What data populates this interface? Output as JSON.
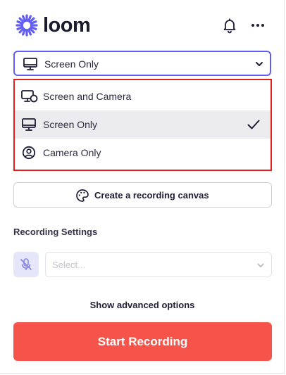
{
  "header": {
    "logo_text": "loom",
    "logo_icon": "loom-starburst-icon",
    "notifications_icon": "bell-icon",
    "more_icon": "more-horizontal-icon"
  },
  "recording_mode": {
    "selected_value": "Screen Only",
    "options": [
      {
        "label": "Screen and Camera",
        "icon": "monitor-camera-icon",
        "selected": false
      },
      {
        "label": "Screen Only",
        "icon": "monitor-icon",
        "selected": true
      },
      {
        "label": "Camera Only",
        "icon": "user-circle-icon",
        "selected": false
      }
    ]
  },
  "canvas_button": {
    "label": "Create a recording canvas",
    "icon": "palette-icon"
  },
  "recording_settings": {
    "title": "Recording Settings",
    "microphone_icon": "microphone-off-icon",
    "microphone_placeholder": "Select..."
  },
  "advanced_label": "Show advanced options",
  "start_button": {
    "label": "Start Recording"
  },
  "colors": {
    "brand": "#625df5",
    "start_button": "#f6544a",
    "highlight_border": "#e0211b",
    "selected_row": "#ececef"
  }
}
